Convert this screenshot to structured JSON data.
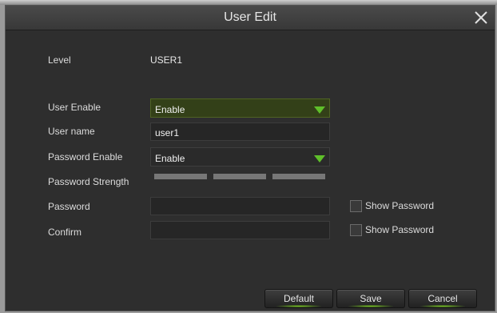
{
  "dialog": {
    "title": "User Edit"
  },
  "form": {
    "level_label": "Level",
    "level_value": "USER1",
    "user_enable_label": "User Enable",
    "user_enable_value": "Enable",
    "user_name_label": "User name",
    "user_name_value": "user1",
    "password_enable_label": "Password Enable",
    "password_enable_value": "Enable",
    "password_strength_label": "Password Strength",
    "password_label": "Password",
    "password_value": "",
    "confirm_label": "Confirm",
    "confirm_value": "",
    "show_password_label": "Show Password",
    "show_password_confirm_label": "Show Password",
    "show_password_checked": false,
    "show_password_confirm_checked": false
  },
  "buttons": {
    "default_label": "Default",
    "save_label": "Save",
    "cancel_label": "Cancel"
  },
  "icons": {
    "close": "close-icon",
    "dropdown": "triangle-down-icon"
  },
  "colors": {
    "accent": "#5fbf2a",
    "active_field_bg": "#334018"
  }
}
